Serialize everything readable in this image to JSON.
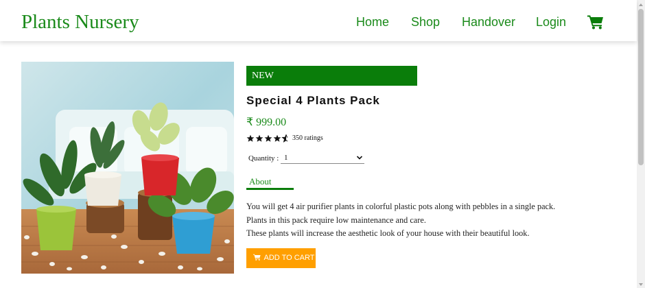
{
  "navbar": {
    "brand": "Plants Nursery",
    "links": [
      "Home",
      "Shop",
      "Handover",
      "Login"
    ],
    "cart_icon": "shopping-cart-icon",
    "accent_color": "#1a8a1a"
  },
  "product": {
    "image_alt": "potted plants",
    "badge": "NEW",
    "title": "Special 4 Plants Pack",
    "price": "₹ 999.00",
    "rating": 4.5,
    "rating_max": 5,
    "ratings_text": "350 ratings",
    "quantity_label": "Quantity :",
    "quantity_value": "1",
    "tab_label": "About",
    "description": [
      "You will get 4 air purifier plants in colorful plastic pots along with pebbles in a single pack.",
      "Plants in this pack require low maintenance and care.",
      "These plants will increase the aesthetic look of your house with their beautiful look."
    ],
    "add_to_cart_label": "ADD TO CART",
    "badge_color": "#0a7d0a",
    "button_color": "#ff9f00"
  }
}
